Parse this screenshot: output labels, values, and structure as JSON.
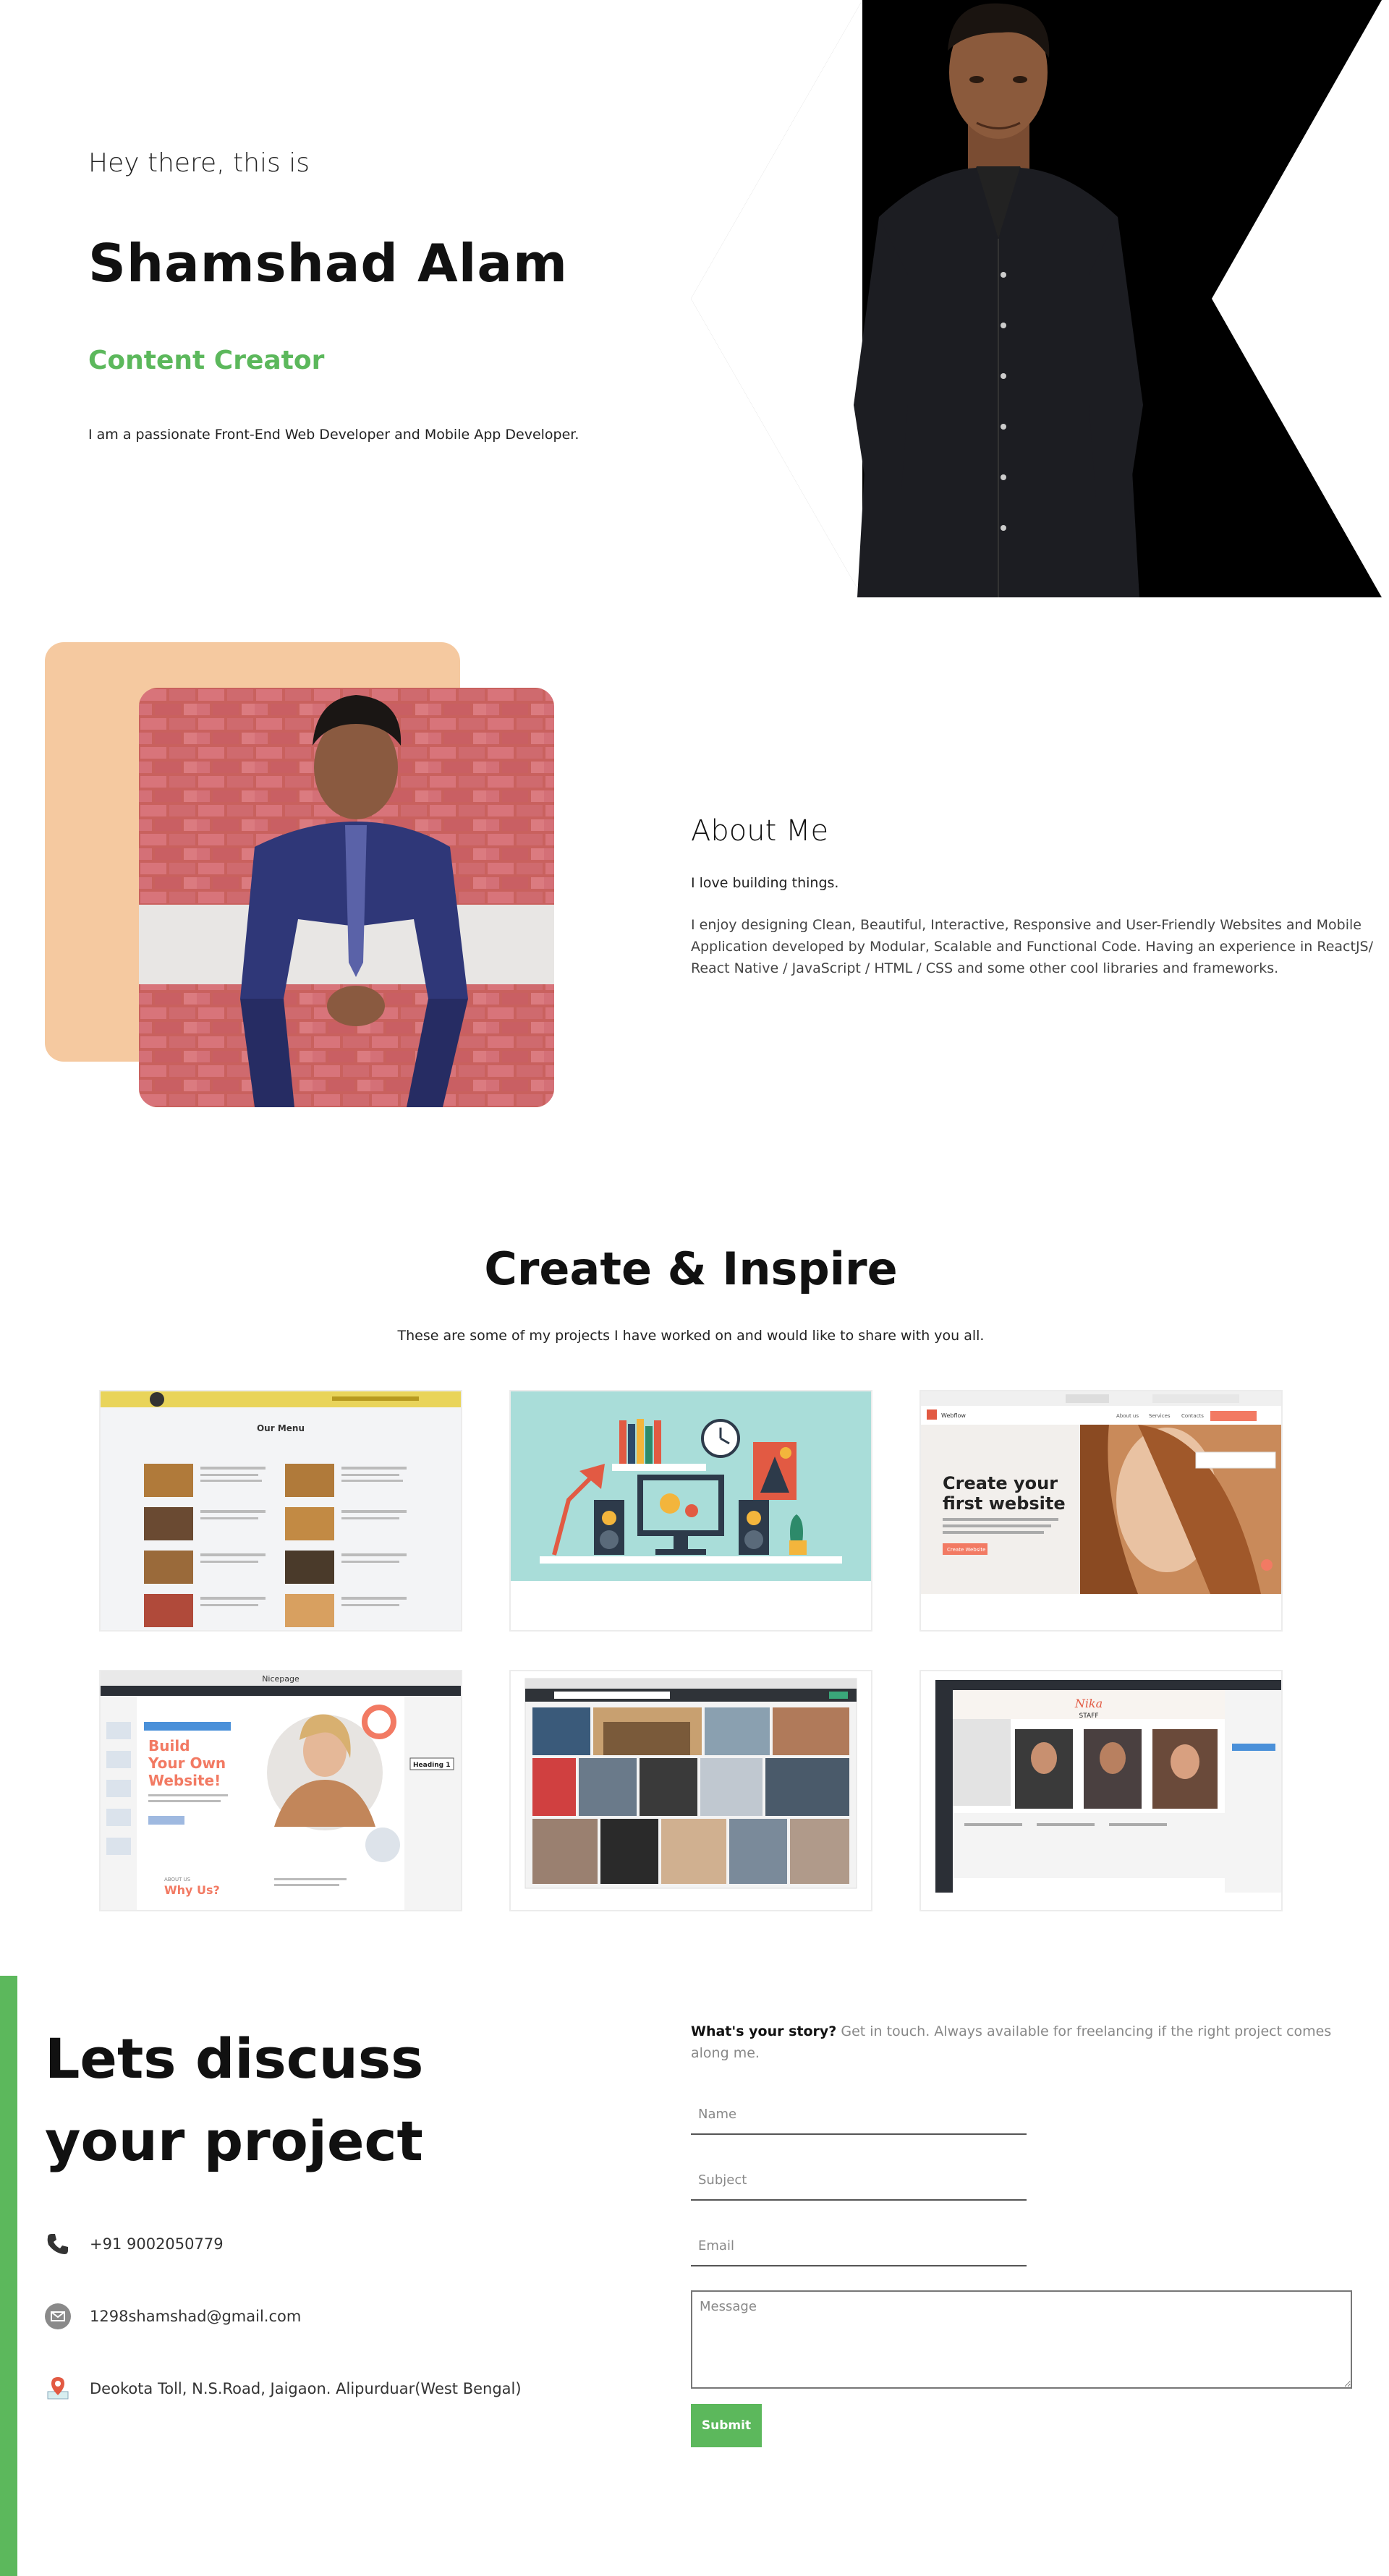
{
  "hero": {
    "greeting": "Hey there, this is",
    "name": "Shamshad Alam",
    "role": "Content Creator",
    "description": "I am a passionate Front-End Web Developer and Mobile App Developer."
  },
  "about": {
    "title": "About Me",
    "tagline": "I love building things.",
    "paragraph": "I enjoy designing Clean, Beautiful, Interactive, Responsive and User-Friendly Websites and Mobile Application developed by Modular, Scalable and Functional Code. Having an experience in ReactJS/ React Native / JavaScript / HTML / CSS and some other cool libraries and frameworks."
  },
  "projects": {
    "title": "Create & Inspire",
    "subtitle": "These are some of my projects I have worked on and would like to share with you all.",
    "card1": {
      "heading": "Our Menu"
    },
    "card3": {
      "heading_line1": "Create your",
      "heading_line2": "first website",
      "button": "Create Website",
      "brand": "Webflow",
      "nav_about": "About us",
      "nav_services": "Services",
      "nav_contacts": "Contacts"
    },
    "card4": {
      "app_title": "Nicepage",
      "heading_line1": "Build",
      "heading_line2": "Your Own",
      "heading_line3": "Website!",
      "about": "ABOUT US",
      "why": "Why Us?",
      "heading_badge": "Heading 1"
    },
    "card6": {
      "logo": "Nika",
      "staff": "STAFF"
    }
  },
  "contact": {
    "title": "Lets discuss your project",
    "phone": "+91 9002050779",
    "email": "1298shamshad@gmail.com",
    "address": "Deokota Toll, N.S.Road, Jaigaon. Alipurduar(West Bengal)",
    "story_lead": "What's your story?",
    "story_text": " Get in touch. Always available for freelancing if the right project comes along me.",
    "name_placeholder": "Name",
    "subject_placeholder": "Subject",
    "email_placeholder": "Email",
    "message_placeholder": "Message",
    "submit_label": "Submit"
  },
  "colors": {
    "accent": "#5cb85c",
    "peach": "#f5c9a0"
  }
}
